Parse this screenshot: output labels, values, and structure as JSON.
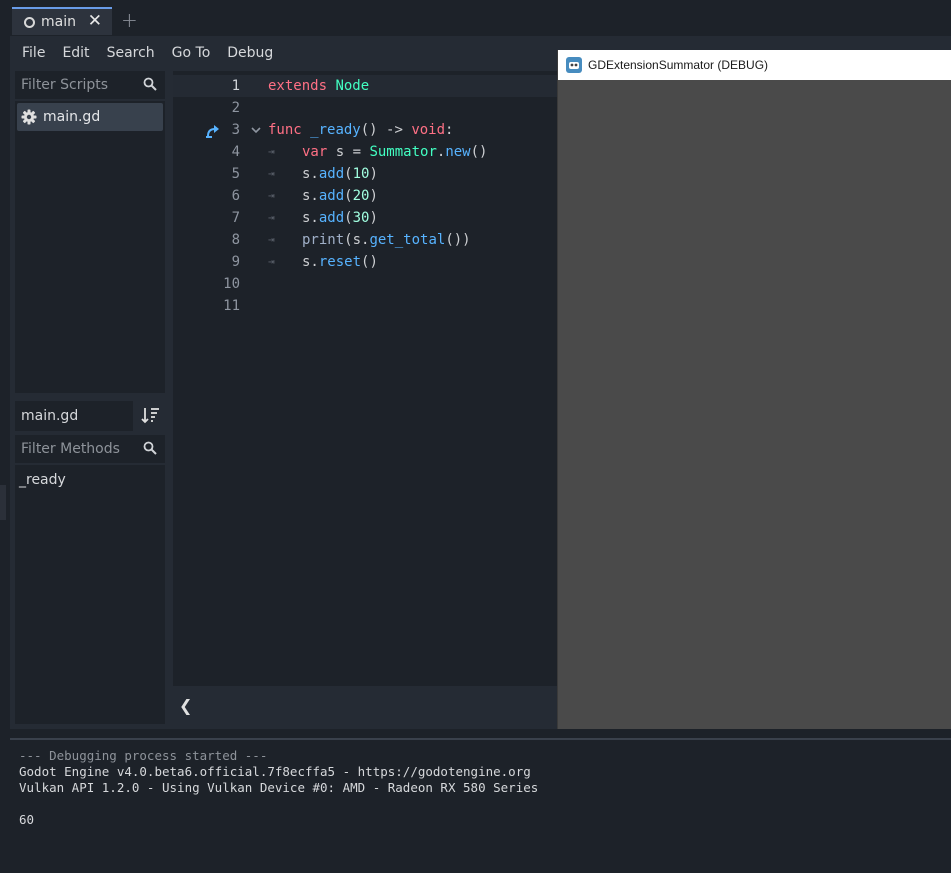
{
  "tabs": {
    "active": "main",
    "close_glyph": "✕",
    "add_glyph": "+"
  },
  "menu": [
    "File",
    "Edit",
    "Search",
    "Go To",
    "Debug"
  ],
  "scripts_panel": {
    "filter_placeholder": "Filter Scripts",
    "items": [
      {
        "label": "main.gd",
        "icon": "gear-icon"
      }
    ]
  },
  "methods_panel": {
    "current_file": "main.gd",
    "filter_placeholder": "Filter Methods",
    "items": [
      "_ready"
    ]
  },
  "editor": {
    "line_numbers": [
      "1",
      "2",
      "3",
      "4",
      "5",
      "6",
      "7",
      "8",
      "9",
      "10",
      "11"
    ],
    "current_line": 1
  },
  "editor_bottom": {
    "toggle_glyph": "❮"
  },
  "debug_window": {
    "title": "GDExtensionSummator (DEBUG)",
    "icon": "godot-icon"
  },
  "output": {
    "lines": [
      "--- Debugging process started ---",
      "Godot Engine v4.0.beta6.official.7f8ecffa5 - https://godotengine.org",
      "Vulkan API 1.2.0 - Using Vulkan Device #0: AMD - Radeon RX 580 Series",
      "",
      "60"
    ]
  },
  "colors": {
    "accent": "#699ce8",
    "keyword": "#ff7085",
    "type": "#42ffc2",
    "function": "#57b3ff",
    "number": "#a1ffe0"
  }
}
